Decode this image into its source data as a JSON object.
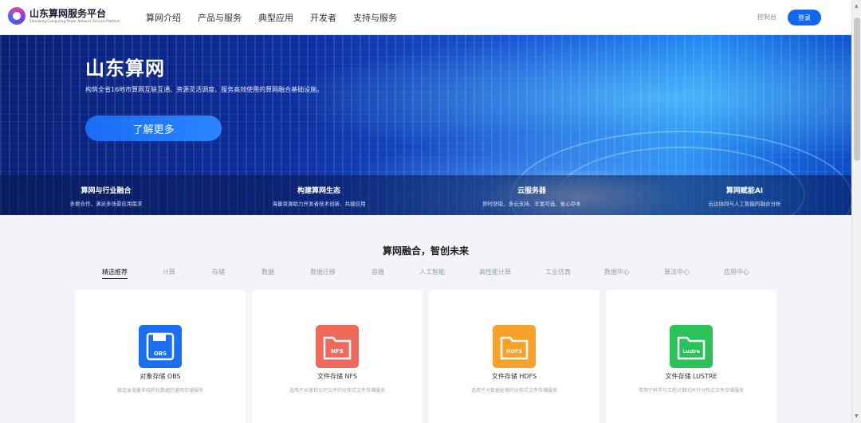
{
  "header": {
    "logo_title": "山东算网服务平台",
    "logo_subtitle": "Shandong Computing Power Network Service Platform",
    "nav": [
      "算网介绍",
      "产品与服务",
      "典型应用",
      "开发者",
      "支持与服务"
    ],
    "console_label": "控制台",
    "login_label": "登录"
  },
  "hero": {
    "title": "山东算网",
    "description": "构筑全省16地市算网互联互通、资源灵活调度、服务高效使用的算网融合基础设施。",
    "button_label": "了解更多",
    "strip": [
      {
        "title": "算网与行业融合",
        "desc": "多要合作，满足多场景应用需求"
      },
      {
        "title": "构建算网生态",
        "desc": "海量资源助力开发者技术创新、共建应用"
      },
      {
        "title": "云服务器",
        "desc": "即时获取、多云支持、丰富可选、省心存本"
      },
      {
        "title": "算网赋能AI",
        "desc": "云边协同与人工智能的融合分析"
      }
    ]
  },
  "section": {
    "title": "算网融合，智创未来",
    "tabs": [
      "精选推荐",
      "计算",
      "存储",
      "数据",
      "数据迁移",
      "容器",
      "人工智能",
      "高性能计算",
      "工业仿真",
      "数据中心",
      "算法中心",
      "应用中心"
    ],
    "active_tab": "精选推荐"
  },
  "cards": [
    {
      "title": "对象存储 OBS",
      "desc": "稳定本海量非结构化数据的通用存储服务",
      "icon_label": "OBS",
      "icon": "floppy-disk-icon",
      "color": "#1a6ef0"
    },
    {
      "title": "文件存储 NFS",
      "desc": "适用于共享和访问文件的分布式文件存储服务",
      "icon_label": "NFS",
      "icon": "folder-icon",
      "color": "#f06a5c"
    },
    {
      "title": "文件存储 HDFS",
      "desc": "适用于大数据处理的分布式文件存储服务",
      "icon_label": "HDFS",
      "icon": "folder-icon",
      "color": "#f7a12b"
    },
    {
      "title": "文件存储 LUSTRE",
      "desc": "常用于科学与工程计算的并行分布式文件存储服务",
      "icon_label": "Lustre",
      "icon": "folder-icon",
      "color": "#2bc25a"
    }
  ]
}
